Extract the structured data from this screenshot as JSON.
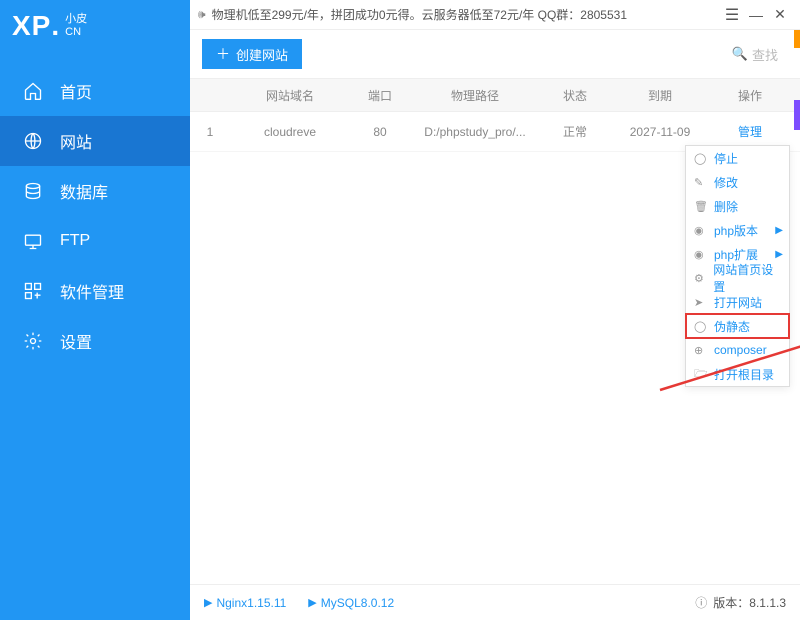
{
  "logo": {
    "xp": "XP",
    "dot": ".",
    "cn_top": "小皮",
    "cn_bottom": "CN"
  },
  "announcement": "物理机低至299元/年，拼团成功0元得。云服务器低至72元/年   QQ群：2805531",
  "nav": [
    {
      "label": "首页",
      "icon": "home"
    },
    {
      "label": "网站",
      "icon": "globe"
    },
    {
      "label": "数据库",
      "icon": "database"
    },
    {
      "label": "FTP",
      "icon": "ftp"
    },
    {
      "label": "软件管理",
      "icon": "apps"
    },
    {
      "label": "设置",
      "icon": "gear"
    }
  ],
  "toolbar": {
    "create": "创建网站",
    "search": "查找"
  },
  "columns": {
    "domain": "网站域名",
    "port": "端口",
    "path": "物理路径",
    "status": "状态",
    "expire": "到期",
    "op": "操作"
  },
  "rows": [
    {
      "idx": "1",
      "domain": "cloudreve",
      "port": "80",
      "path": "D:/phpstudy_pro/...",
      "status": "正常",
      "expire": "2027-11-09",
      "op": "管理"
    }
  ],
  "dropdown": [
    {
      "label": "停止",
      "icon": "◯"
    },
    {
      "label": "修改",
      "icon": "✎"
    },
    {
      "label": "删除",
      "icon": "🗑"
    },
    {
      "label": "php版本",
      "icon": "◉",
      "sub": true
    },
    {
      "label": "php扩展",
      "icon": "◉",
      "sub": true
    },
    {
      "label": "网站首页设置",
      "icon": "⚙"
    },
    {
      "label": "打开网站",
      "icon": "➤"
    },
    {
      "label": "伪静态",
      "icon": "◯",
      "hl": true
    },
    {
      "label": "composer",
      "icon": "⊕"
    },
    {
      "label": "打开根目录",
      "icon": "🗁"
    }
  ],
  "status": {
    "nginx": "Nginx1.15.11",
    "mysql": "MySQL8.0.12",
    "version_label": "版本：",
    "version": "8.1.1.3"
  }
}
